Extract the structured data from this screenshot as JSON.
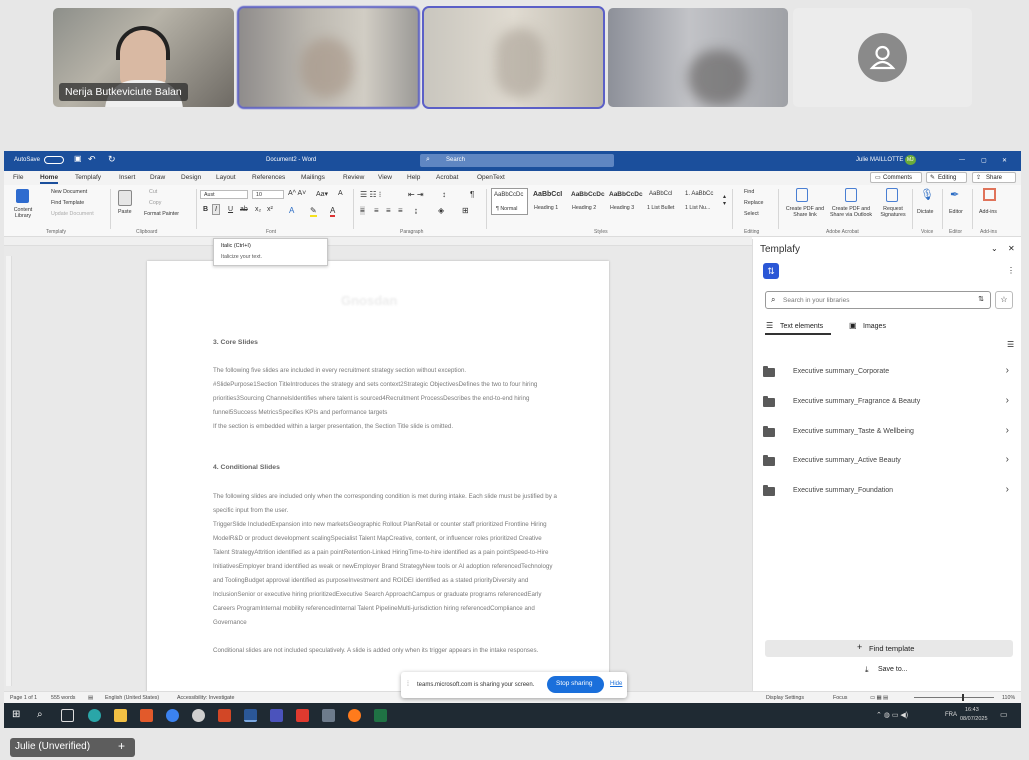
{
  "participants": [
    {
      "name": "Nerija Butkeviciute Balan"
    },
    {
      "name": ""
    },
    {
      "name": ""
    },
    {
      "name": ""
    },
    {
      "name": ""
    }
  ],
  "word": {
    "autosave": "AutoSave",
    "doc_title": "Document2 - Word",
    "search_placeholder": "Search",
    "user": "Julie MAILLOTTE",
    "user_initials": "MJ",
    "menu_tabs": [
      "File",
      "Home",
      "Templafy",
      "Insert",
      "Draw",
      "Design",
      "Layout",
      "References",
      "Mailings",
      "Review",
      "View",
      "Help",
      "Acrobat",
      "OpenText"
    ],
    "comments": "Comments",
    "editing": "Editing",
    "share": "Share",
    "ribbon": {
      "content_library": "Content Library",
      "new_document": "New Document",
      "find_template": "Find Template",
      "update_document": "Update Document",
      "templafy_group": "Templafy",
      "paste": "Paste",
      "cut": "Cut",
      "copy": "Copy",
      "format_painter": "Format Painter",
      "clipboard_group": "Clipboard",
      "font_name": "Aust",
      "font_size": "10",
      "font_group": "Font",
      "paragraph_group": "Paragraph",
      "styles": [
        "AaBbCcDc",
        "AaBbCcI",
        "AaBbCcDc",
        "AaBbCcDc",
        "AaBbCcl",
        "1. AaBbCc"
      ],
      "style_names": [
        "¶ Normal",
        "Heading 1",
        "Heading 2",
        "Heading 3",
        "1 List Bullet",
        "1 List Nu..."
      ],
      "styles_group": "Styles",
      "find": "Find",
      "replace": "Replace",
      "select": "Select",
      "editing_group": "Editing",
      "create_pdf_share": "Create PDF and Share link",
      "create_pdf_outlook": "Create PDF and Share via Outlook",
      "request_signatures": "Request Signatures",
      "acrobat_group": "Adobe Acrobat",
      "dictate": "Dictate",
      "voice_group": "Voice",
      "editor": "Editor",
      "editor_group": "Editor",
      "addins": "Add-ins",
      "addins_group": "Add-ins"
    },
    "tooltip": {
      "title": "Italic (Ctrl+I)",
      "body": "Italicize your text."
    },
    "document": {
      "heading_faded": "Gnosdan",
      "section3_title": "3. Core Slides",
      "section3_paras": [
        "The following five slides are included in every recruitment strategy section without exception.",
        "#SlidePurpose1Section TitleIntroduces the strategy and sets context2Strategic ObjectivesDefines the two to four hiring priorities3Sourcing ChannelsIdentifies where talent is sourced4Recruitment ProcessDescribes the end-to-end hiring funnel5Success MetricsSpecifies KPIs and performance targets",
        "If the section is embedded within a larger presentation, the Section Title slide is omitted."
      ],
      "section4_title": "4. Conditional Slides",
      "section4_paras": [
        "The following slides are included only when the corresponding condition is met during intake. Each slide must be justified by a specific input from the user.",
        "TriggerSlide IncludedExpansion into new marketsGeographic Rollout PlanRetail or counter staff prioritized Frontline Hiring ModelR&D or product development scalingSpecialist Talent MapCreative, content, or influencer roles prioritized Creative Talent StrategyAttrition identified as a pain pointRetention-Linked HiringTime-to-hire identified as a pain pointSpeed-to-Hire InitiativesEmployer brand identified as weak or newEmployer Brand StrategyNew tools or AI adoption referencedTechnology and ToolingBudget approval identified as purposeInvestment and ROIDEI identified as a stated priorityDiversity and InclusionSenior or executive hiring prioritizedExecutive Search ApproachCampus or graduate programs referencedEarly Careers ProgramInternal mobility referencedInternal Talent PipelineMulti-jurisdiction hiring referencedCompliance and Governance",
        "Conditional slides are not included speculatively. A slide is added only when its trigger appears in the intake responses."
      ]
    },
    "templafy": {
      "title": "Templafy",
      "search_placeholder": "Search in your libraries",
      "tab_text": "Text elements",
      "tab_images": "Images",
      "items": [
        "Executive summary_Corporate",
        "Executive summary_Fragrance & Beauty",
        "Executive summary_Taste & Wellbeing",
        "Executive summary_Active Beauty",
        "Executive summary_Foundation"
      ],
      "find_template": "Find template",
      "save_to": "Save to..."
    },
    "status": {
      "page": "Page 1 of 1",
      "words": "555 words",
      "language": "English (United States)",
      "accessibility": "Accessibility: Investigate",
      "display_settings": "Display Settings",
      "focus": "Focus",
      "zoom": "110%"
    },
    "taskbar": {
      "time": "16:43",
      "date": "08/07/2025",
      "lang": "FRA"
    }
  },
  "share_bar": {
    "message": "teams.microsoft.com is sharing your screen.",
    "stop": "Stop sharing",
    "hide": "Hide"
  },
  "bottom_label": "Julie (Unverified)",
  "colors": {
    "word_blue": "#1b4f9c",
    "teams_purple": "#5b5fc7",
    "stop_blue": "#1a6fdb"
  }
}
